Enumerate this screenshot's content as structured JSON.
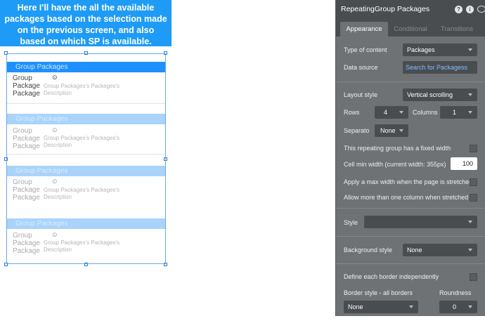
{
  "callout": {
    "text": "Here I'll have the  all the available packages based on the selection made on the previous screen, and also based on which SP is available."
  },
  "repeating_group": {
    "cells": [
      {
        "header": "Group Packages",
        "group_lines": [
          "Group",
          "Package",
          "Package"
        ],
        "description": "Group Packages's Packages's Description",
        "state": "active"
      },
      {
        "header": "Group Packages",
        "group_lines": [
          "Group",
          "Package",
          "Package"
        ],
        "description": "Group Packages's Packages's Description",
        "state": "faint"
      },
      {
        "header": "Group Packages",
        "group_lines": [
          "Group",
          "Package",
          "Package"
        ],
        "description": "Group Packages's Packages's Description",
        "state": "faint"
      },
      {
        "header": "Group Packages",
        "group_lines": [
          "Group",
          "Package",
          "Package"
        ],
        "description": "Group Packages's Packages's Description",
        "state": "faint"
      }
    ],
    "clock_icon": "clock-icon"
  },
  "panel": {
    "title": "RepeatingGroup Packages",
    "header_icons": [
      "help-icon",
      "info-icon",
      "comment-icon"
    ],
    "tabs": [
      {
        "label": "Appearance",
        "active": true
      },
      {
        "label": "Conditional",
        "active": false
      },
      {
        "label": "Transitions",
        "active": false
      }
    ],
    "type_of_content": {
      "label": "Type of content",
      "value": "Packages"
    },
    "data_source": {
      "label": "Data source",
      "value": "Search for Packagess"
    },
    "layout_style": {
      "label": "Layout style",
      "value": "Vertical scrolling"
    },
    "rows": {
      "label": "Rows",
      "value": "4"
    },
    "columns": {
      "label": "Columns",
      "value": "1"
    },
    "separator": {
      "label": "Separato",
      "value": "None"
    },
    "fixed_width": {
      "label": "This repeating group has a fixed width"
    },
    "cell_min_width": {
      "label": "Cell min width (current width: 355px)",
      "value": "100"
    },
    "max_width": {
      "label": "Apply a max width when the page is stretched"
    },
    "more_columns": {
      "label": "Allow more than one column when stretched"
    },
    "style": {
      "label": "Style",
      "value": ""
    },
    "background_style": {
      "label": "Background style",
      "value": "None"
    },
    "border_independent": {
      "label": "Define each border independently"
    },
    "border_style": {
      "label": "Border style - all borders",
      "value": "None"
    },
    "roundness": {
      "label": "Roundness",
      "value": "0"
    }
  }
}
